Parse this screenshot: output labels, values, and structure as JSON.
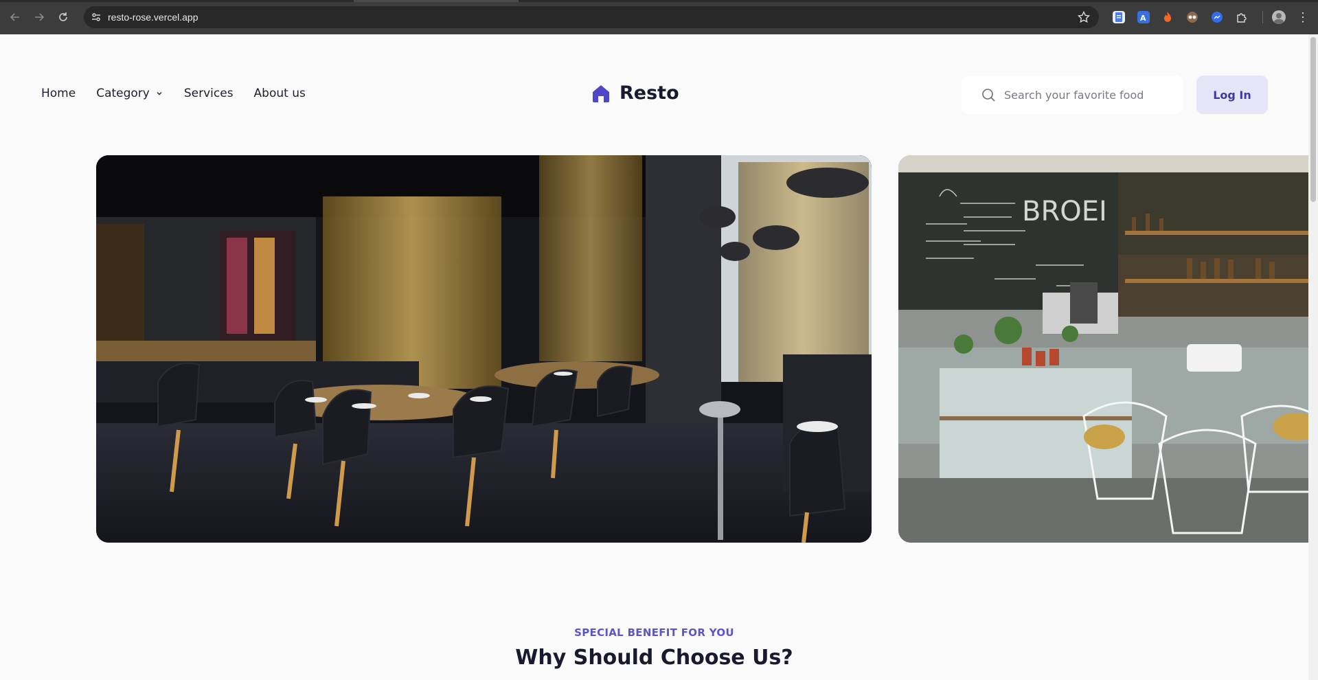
{
  "browser": {
    "url": "resto-rose.vercel.app",
    "icons": [
      "back-icon",
      "forward-icon",
      "reload-icon",
      "site-settings-icon",
      "bookmark-star-icon",
      "extension-docs-icon",
      "extension-translate-icon",
      "extension-flame-icon",
      "extension-glasses-icon",
      "extension-messenger-icon",
      "extensions-puzzle-icon",
      "profile-avatar",
      "menu-kebab-icon"
    ]
  },
  "nav": {
    "home": "Home",
    "category": "Category",
    "services": "Services",
    "about": "About us"
  },
  "logo": {
    "name": "Resto",
    "color": "#4f46c8"
  },
  "search": {
    "placeholder": "Search your favorite food"
  },
  "login": {
    "label": "Log In"
  },
  "carousel": {
    "slides": [
      "restaurant-interior-photo",
      "cafe-counter-photo"
    ]
  },
  "benefits": {
    "eyebrow": "SPECIAL BENEFIT FOR YOU",
    "title": "Why Should Choose Us?"
  },
  "colors": {
    "accent": "#4f46c8",
    "login_bg": "#e6e4f7",
    "page_bg": "#fafafa"
  }
}
